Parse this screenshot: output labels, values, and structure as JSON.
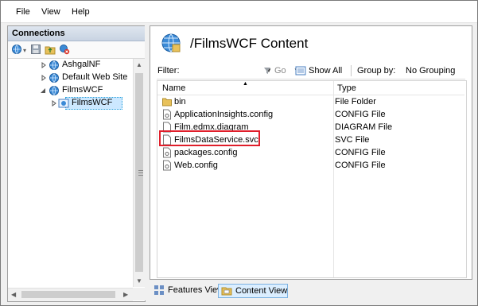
{
  "menu": {
    "file": "File",
    "view": "View",
    "help": "Help"
  },
  "connections": {
    "title": "Connections",
    "tree": [
      {
        "label": "AshgalNF",
        "expanded": false
      },
      {
        "label": "Default Web Site",
        "expanded": false
      },
      {
        "label": "FilmsWCF",
        "expanded": true
      },
      {
        "label": "FilmsWCF",
        "expanded": false,
        "selected": true
      }
    ]
  },
  "main": {
    "title": "/FilmsWCF Content",
    "filter": {
      "label": "Filter:",
      "value": "",
      "go_label": "Go",
      "show_all_label": "Show All",
      "group_by_label": "Group by:",
      "group_by_value": "No Grouping"
    },
    "table": {
      "columns": {
        "name": "Name",
        "type": "Type"
      },
      "rows": [
        {
          "name": "bin",
          "type": "File Folder",
          "icon": "folder-icon"
        },
        {
          "name": "ApplicationInsights.config",
          "type": "CONFIG File",
          "icon": "config-file-icon"
        },
        {
          "name": "Film.edmx.diagram",
          "type": "DIAGRAM File",
          "icon": "file-icon"
        },
        {
          "name": "FilmsDataService.svc",
          "type": "SVC File",
          "icon": "file-icon"
        },
        {
          "name": "packages.config",
          "type": "CONFIG File",
          "icon": "config-file-icon"
        },
        {
          "name": "Web.config",
          "type": "CONFIG File",
          "icon": "config-file-icon"
        }
      ]
    }
  },
  "views": {
    "features": "Features View",
    "content": "Content View",
    "active": "content"
  },
  "colors": {
    "selection": "#cce8ff",
    "highlight": "#e01e2a",
    "active_view": "#dbeeff"
  }
}
